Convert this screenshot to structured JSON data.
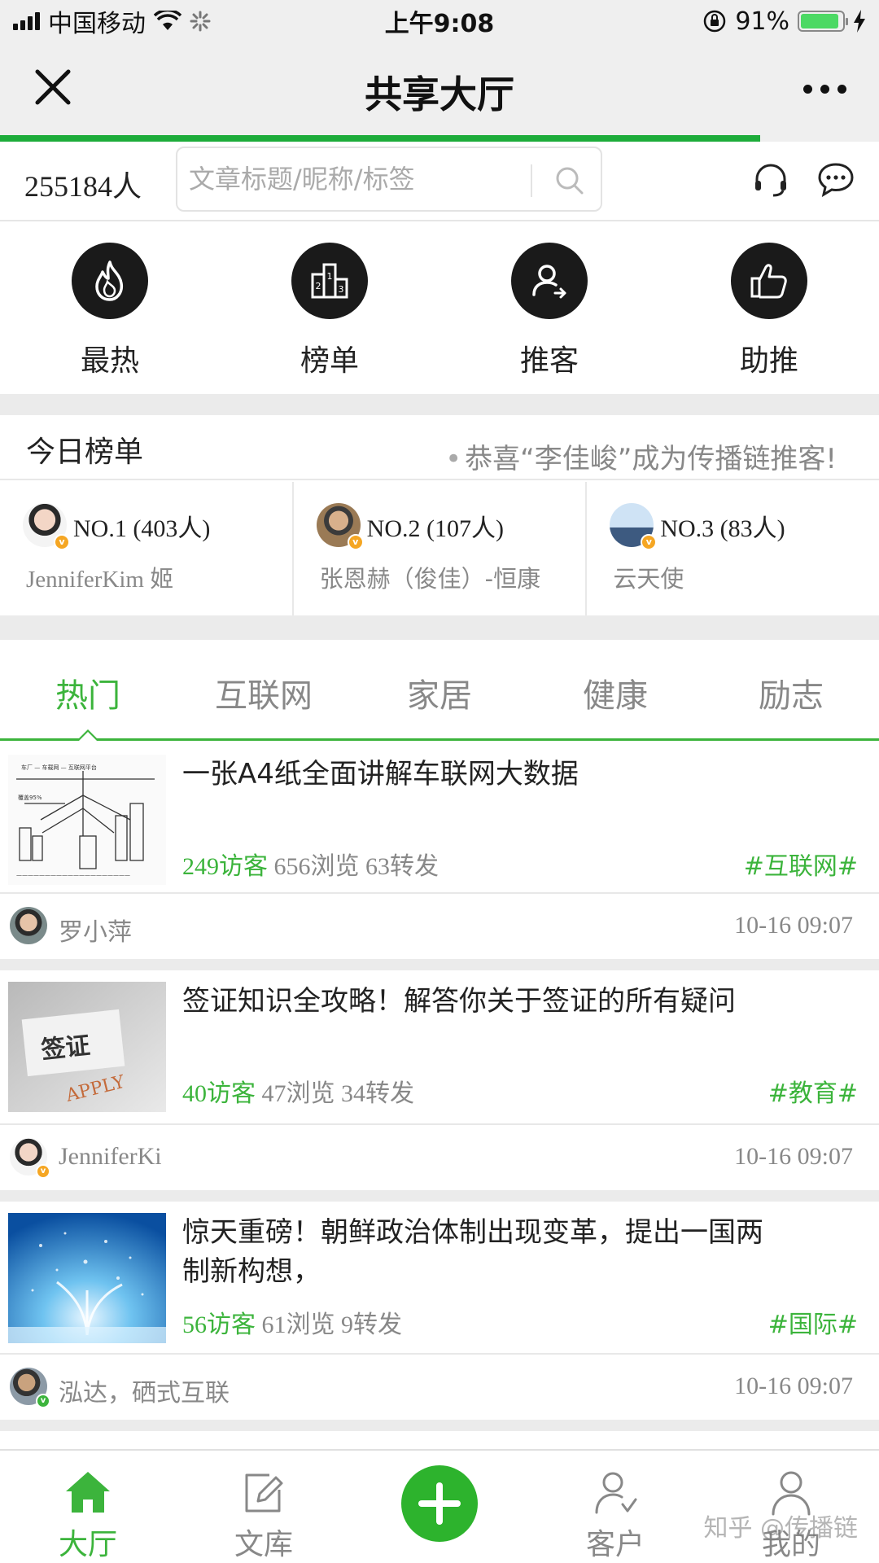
{
  "status_bar": {
    "carrier": "中国移动",
    "time": "上午9:08",
    "battery": "91%",
    "battery_level": 0.91
  },
  "nav": {
    "title": "共享大厅",
    "load_progress": 0.865
  },
  "header": {
    "member_count": "255184人",
    "search_placeholder": "文章标题/昵称/标签"
  },
  "quick_menu": [
    {
      "label": "最热",
      "icon": "flame-icon"
    },
    {
      "label": "榜单",
      "icon": "podium-icon"
    },
    {
      "label": "推客",
      "icon": "user-share-icon"
    },
    {
      "label": "助推",
      "icon": "thumbs-up-icon"
    }
  ],
  "ranking": {
    "title": "今日榜单",
    "notice": "恭喜“李佳峻”成为传播链推客!",
    "items": [
      {
        "rank": "NO.1 (403人)",
        "name": "JenniferKim 姬"
      },
      {
        "rank": "NO.2 (107人)",
        "name": "张恩赫（俊佳）-恒康"
      },
      {
        "rank": "NO.3 (83人)",
        "name": "云天使"
      }
    ]
  },
  "tabs": [
    "热门",
    "互联网",
    "家居",
    "健康",
    "励志"
  ],
  "articles": [
    {
      "title": "一张A4纸全面讲解车联网大数据",
      "visitors": "249访客",
      "views": "656浏览",
      "shares": "63转发",
      "tag": "#互联网#",
      "author": "罗小萍",
      "time": "10-16 09:07"
    },
    {
      "title": "签证知识全攻略！解答你关于签证的所有疑问",
      "visitors": "40访客",
      "views": "47浏览",
      "shares": "34转发",
      "tag": "#教育#",
      "author": "JenniferKi",
      "time": "10-16 09:07"
    },
    {
      "title": "惊天重磅！朝鲜政治体制出现变革，提出一国两制新构想，",
      "visitors": "56访客",
      "views": "61浏览",
      "shares": "9转发",
      "tag": "#国际#",
      "author": "泓达，硒式互联",
      "time": "10-16 09:07"
    }
  ],
  "bottom_nav": [
    {
      "label": "大厅",
      "icon": "home-icon",
      "active": true
    },
    {
      "label": "文库",
      "icon": "edit-icon",
      "active": false
    },
    {
      "label": "",
      "icon": "plus-icon",
      "active": false
    },
    {
      "label": "客户",
      "icon": "customer-icon",
      "active": false
    },
    {
      "label": "我的",
      "icon": "user-icon",
      "active": false
    }
  ],
  "watermark": "知乎 @传播链",
  "colors": {
    "accent": "#3cb43c",
    "progress": "#1dac3a",
    "dark_icon": "#1a1a1a",
    "badge": "#f5a623"
  }
}
